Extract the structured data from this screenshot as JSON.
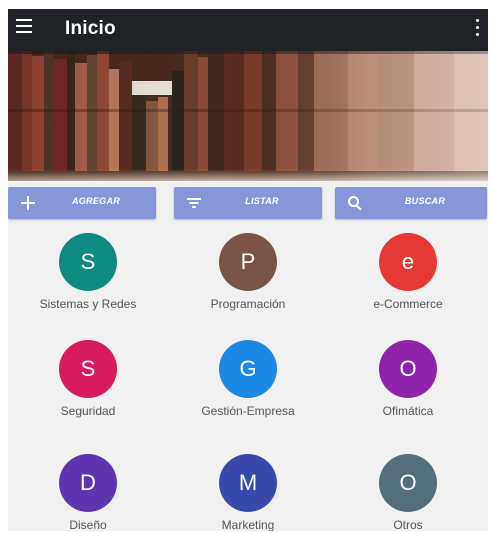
{
  "appbar": {
    "title": "Inicio",
    "menu_icon": "hamburger-menu-icon",
    "more_icon": "more-vertical-icon",
    "background": "#1f2327"
  },
  "banner": {
    "image": "library-bookshelf-photo"
  },
  "actions": [
    {
      "label": "AGREGAR",
      "icon": "plus-icon"
    },
    {
      "label": "LISTAR",
      "icon": "filter-list-icon"
    },
    {
      "label": "BUSCAR",
      "icon": "search-icon"
    }
  ],
  "accent_color": "#8796d8",
  "categories": [
    {
      "letter": "S",
      "label": "Sistemas y Redes",
      "color": "#0f8a7e"
    },
    {
      "letter": "P",
      "label": "Programación",
      "color": "#7a5446"
    },
    {
      "letter": "e",
      "label": "e-Commerce",
      "color": "#e53935"
    },
    {
      "letter": "S",
      "label": "Seguridad",
      "color": "#d81b60"
    },
    {
      "letter": "G",
      "label": "Gestión-Empresa",
      "color": "#1e88e5"
    },
    {
      "letter": "O",
      "label": "Ofimática",
      "color": "#8e24aa"
    },
    {
      "letter": "D",
      "label": "Diseño",
      "color": "#5e35b1"
    },
    {
      "letter": "M",
      "label": "Marketing",
      "color": "#3949ab"
    },
    {
      "letter": "O",
      "label": "Otros",
      "color": "#546e7a"
    }
  ]
}
